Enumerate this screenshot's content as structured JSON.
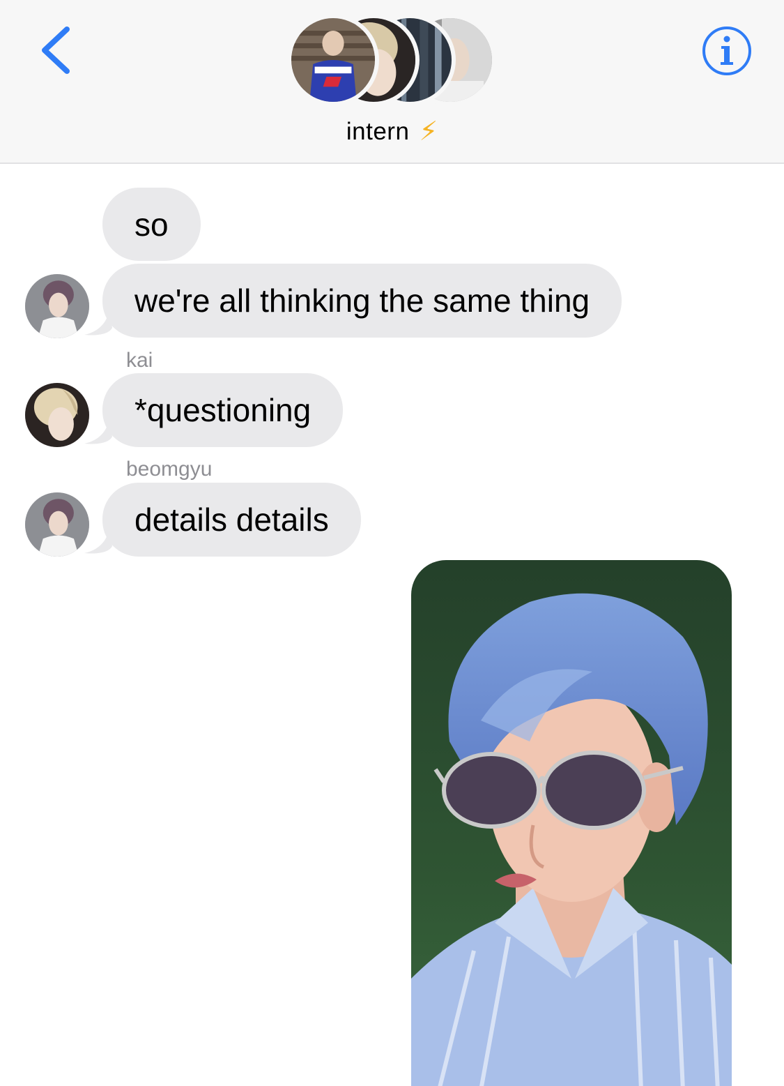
{
  "header": {
    "back_icon": "chevron-left-icon",
    "info_icon": "info-circle-icon",
    "group_name": "intern",
    "group_emoji": "⚡",
    "accent_color": "#2f7cf6"
  },
  "messages": [
    {
      "text": "so"
    },
    {
      "text": "we're all thinking the same thing"
    },
    {
      "sender": "kai",
      "text": "*questioning"
    },
    {
      "sender": "beomgyu",
      "text": "details details"
    }
  ],
  "colors": {
    "incoming_bubble": "#e9e9eb",
    "sender_label": "#8e8e93",
    "header_bg": "#f7f7f7"
  }
}
